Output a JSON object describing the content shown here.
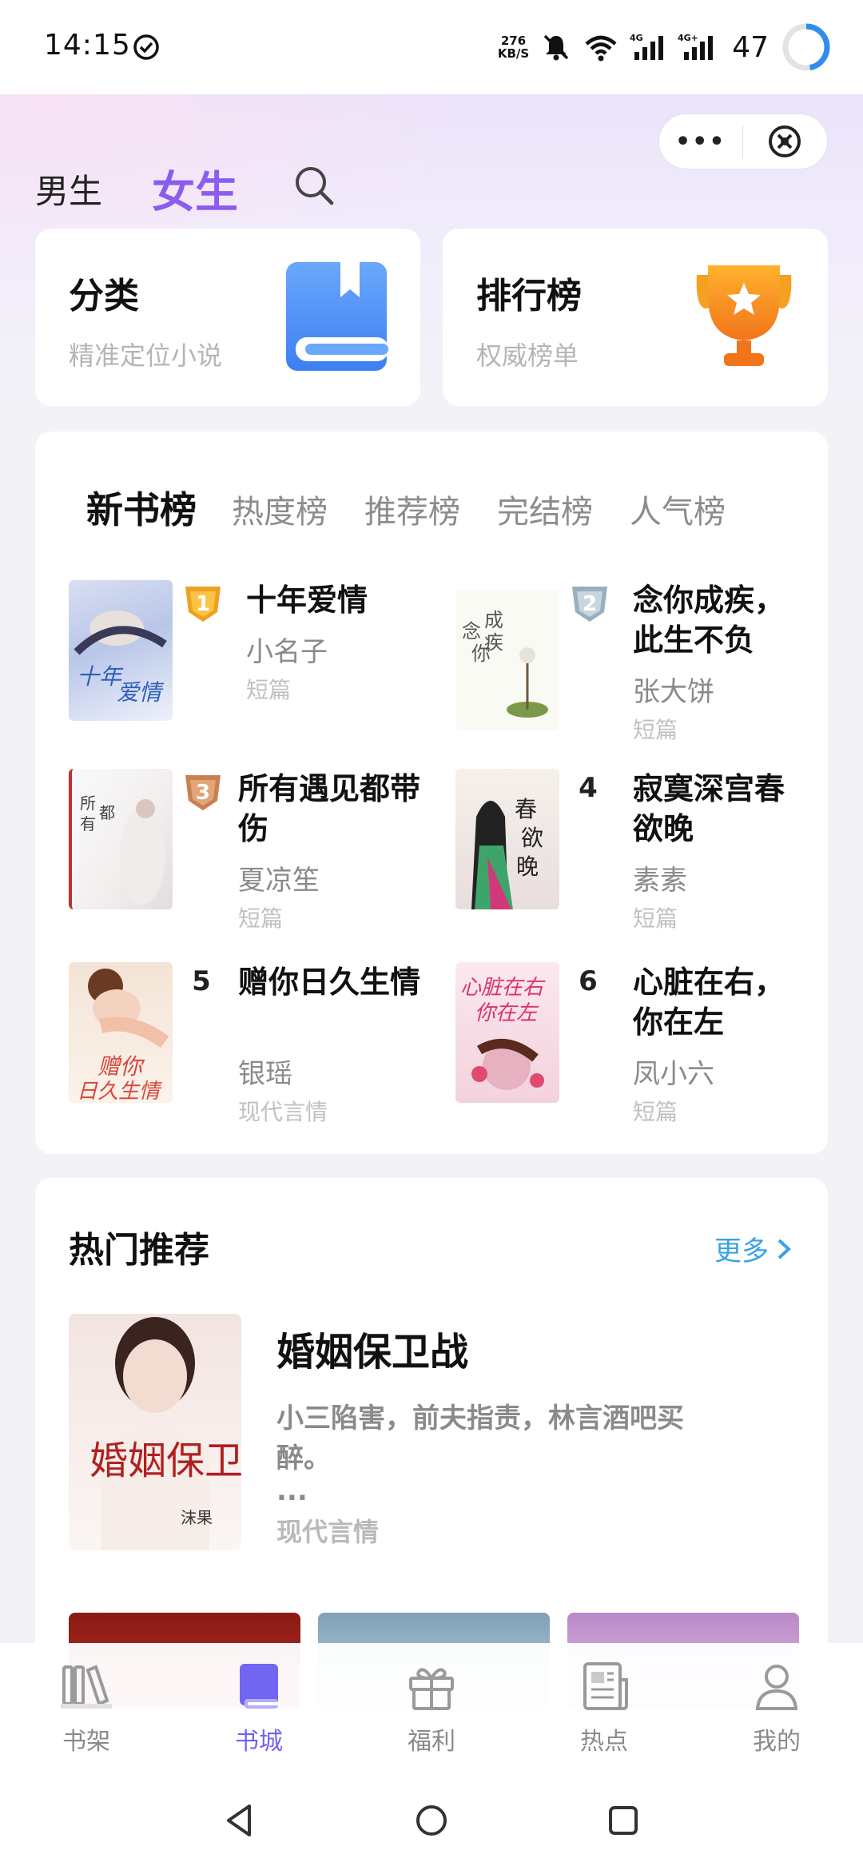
{
  "status_bar": {
    "time": "14:15",
    "net_speed_value": "276",
    "net_speed_unit": "KB/S",
    "signal_1": "4G",
    "signal_2": "4G+",
    "battery": "47"
  },
  "capsule": {
    "more_icon": "more-dots-icon",
    "close_icon": "close-circle-icon"
  },
  "gender_tabs": {
    "male": "男生",
    "female": "女生",
    "active": "female"
  },
  "entry_cards": [
    {
      "title": "分类",
      "subtitle": "精准定位小说",
      "icon": "book-icon",
      "color": "#4a90f7"
    },
    {
      "title": "排行榜",
      "subtitle": "权威榜单",
      "icon": "trophy-icon",
      "color": "#f5901e"
    }
  ],
  "ranking": {
    "tabs": [
      "新书榜",
      "热度榜",
      "推荐榜",
      "完结榜",
      "人气榜"
    ],
    "active_tab": "新书榜",
    "books": [
      {
        "rank": "1",
        "title": "十年爱情",
        "author": "小名子",
        "tag": "短篇"
      },
      {
        "rank": "2",
        "title": "念你成疾，此生不负",
        "author": "张大饼",
        "tag": "短篇"
      },
      {
        "rank": "3",
        "title": "所有遇见都带伤",
        "author": "夏凉笙",
        "tag": "短篇"
      },
      {
        "rank": "4",
        "title": "寂寞深宫春欲晚",
        "author": "素素",
        "tag": "短篇"
      },
      {
        "rank": "5",
        "title": "赠你日久生情",
        "author": "银瑶",
        "tag": "现代言情"
      },
      {
        "rank": "6",
        "title": "心脏在右，你在左",
        "author": "凤小六",
        "tag": "短篇"
      }
    ]
  },
  "hot": {
    "title": "热门推荐",
    "more": "更多",
    "book": {
      "title": "婚姻保卫战",
      "desc": "小三陷害，前夫指责，林言酒吧买醉。",
      "ellipsis": "...",
      "tag": "现代言情",
      "cover_text": "婚姻保卫战",
      "cover_author": "沫果"
    }
  },
  "bottom_nav": [
    {
      "label": "书架",
      "icon": "bookshelf-icon"
    },
    {
      "label": "书城",
      "icon": "bookstore-icon",
      "active": true
    },
    {
      "label": "福利",
      "icon": "gift-icon"
    },
    {
      "label": "热点",
      "icon": "news-icon"
    },
    {
      "label": "我的",
      "icon": "profile-icon"
    }
  ],
  "colors": {
    "accent": "#8a5cf0",
    "nav_active": "#6f63f0",
    "link": "#3aa2e6"
  }
}
